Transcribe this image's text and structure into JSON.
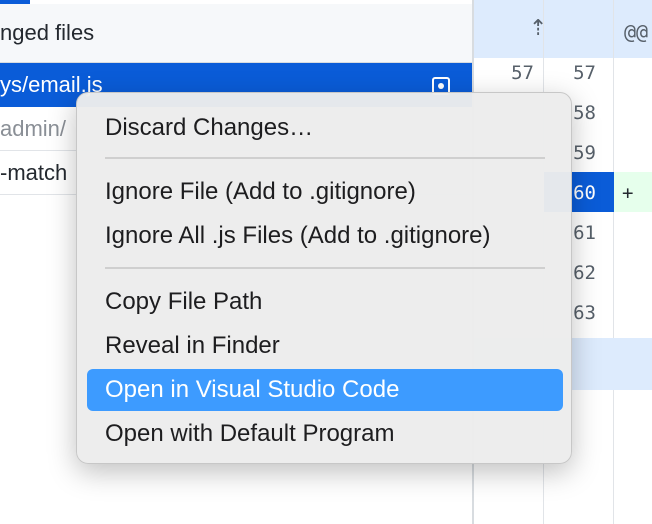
{
  "file_list": {
    "header": "nged files",
    "rows": [
      {
        "text": "ys/email.js",
        "state": "selected"
      },
      {
        "text": "admin/",
        "state": "muted"
      },
      {
        "text": "-match",
        "state": "normal"
      }
    ]
  },
  "diff": {
    "hunk_text": "@@",
    "old_line_numbers": [
      "57"
    ],
    "new_line_numbers": [
      "57",
      "58",
      "59",
      "60",
      "61",
      "62",
      "63"
    ],
    "added_marker": "+"
  },
  "context_menu": {
    "items": [
      {
        "label": "Discard Changes…"
      },
      {
        "label": "Ignore File (Add to .gitignore)"
      },
      {
        "label": "Ignore All .js Files (Add to .gitignore)"
      },
      {
        "label": "Copy File Path"
      },
      {
        "label": "Reveal in Finder"
      },
      {
        "label": "Open in Visual Studio Code",
        "highlighted": true
      },
      {
        "label": "Open with Default Program"
      }
    ]
  },
  "colors": {
    "accent": "#0a5cd8",
    "menu_highlight": "#3d9bff",
    "added_bg": "#e6ffec",
    "hunk_bg": "#ddebfd"
  },
  "icons": {
    "expand": "expand-up-icon",
    "file_status": "modified-status-icon"
  }
}
